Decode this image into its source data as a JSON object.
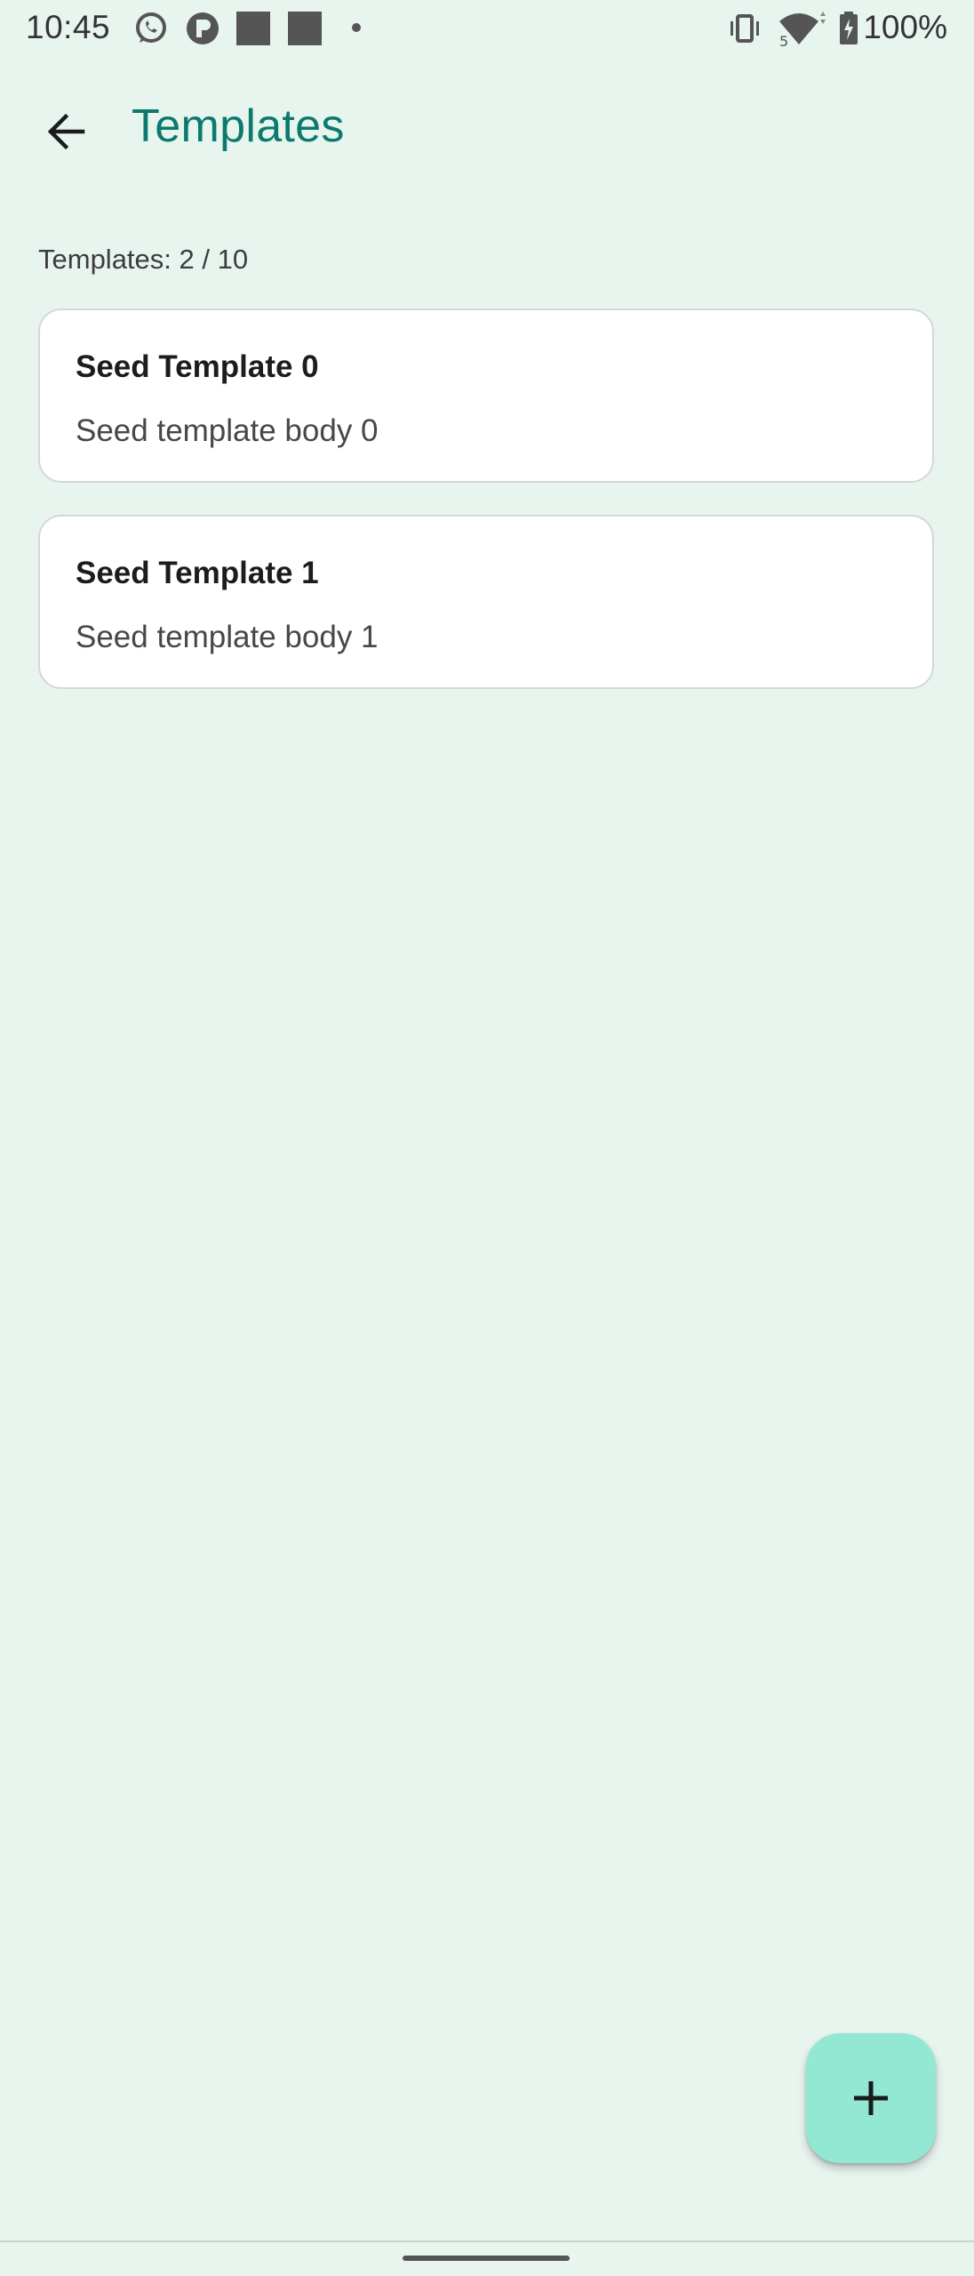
{
  "status_bar": {
    "time": "10:45",
    "battery_text": "100%",
    "icons": [
      "whatsapp-icon",
      "app-p-icon",
      "square-notification-icon",
      "square-notification-icon",
      "dot-icon",
      "vibrate-icon",
      "wifi-icon",
      "battery-charging-icon"
    ]
  },
  "app_bar": {
    "back_icon": "arrow-left-icon",
    "title": "Templates"
  },
  "list": {
    "count_text": "Templates: 2 / 10",
    "items": [
      {
        "title": "Seed Template 0",
        "body": "Seed template body 0"
      },
      {
        "title": "Seed Template 1",
        "body": "Seed template body 1"
      }
    ]
  },
  "fab": {
    "icon": "plus-icon"
  },
  "colors": {
    "background": "#e8f5ee",
    "title": "#0b7a6e",
    "fab": "#93e8d4",
    "card": "#ffffff"
  }
}
